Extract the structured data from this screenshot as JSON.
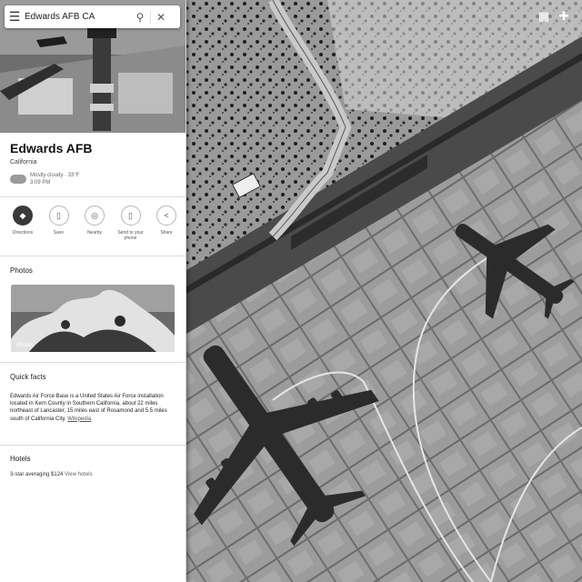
{
  "search": {
    "value": "Edwards AFB CA",
    "menu_icon": "hamburger-icon",
    "search_icon": "search-icon",
    "close_icon": "close-icon"
  },
  "place": {
    "title": "Edwards AFB",
    "subtitle": "California",
    "weather_line1": "Mostly cloudy · 33°F",
    "weather_line2": "3:09 PM"
  },
  "actions": [
    {
      "label": "Directions",
      "icon": "directions-icon",
      "glyph": "◆"
    },
    {
      "label": "Save",
      "icon": "bookmark-icon",
      "glyph": "▯"
    },
    {
      "label": "Nearby",
      "icon": "nearby-icon",
      "glyph": "◎"
    },
    {
      "label": "Send to your phone",
      "icon": "phone-icon",
      "glyph": "▯"
    },
    {
      "label": "Share",
      "icon": "share-icon",
      "glyph": "<"
    }
  ],
  "photos": {
    "title": "Photos",
    "card_label": "Photos"
  },
  "quick_facts": {
    "title": "Quick facts",
    "body": "Edwards Air Force Base is a United States Air Force installation located in Kern County in Southern California, about 22 miles northeast of Lancaster, 15 miles east of Rosamond and 5.5 miles south of California City.",
    "source": "Wikipedia"
  },
  "hotels": {
    "title": "Hotels",
    "text": "3-star averaging $124",
    "link": "View hotels"
  },
  "colors": {
    "panel_bg": "#ffffff",
    "primary_action": "#3a3a3a",
    "map_ground": "#7a7a7a"
  }
}
